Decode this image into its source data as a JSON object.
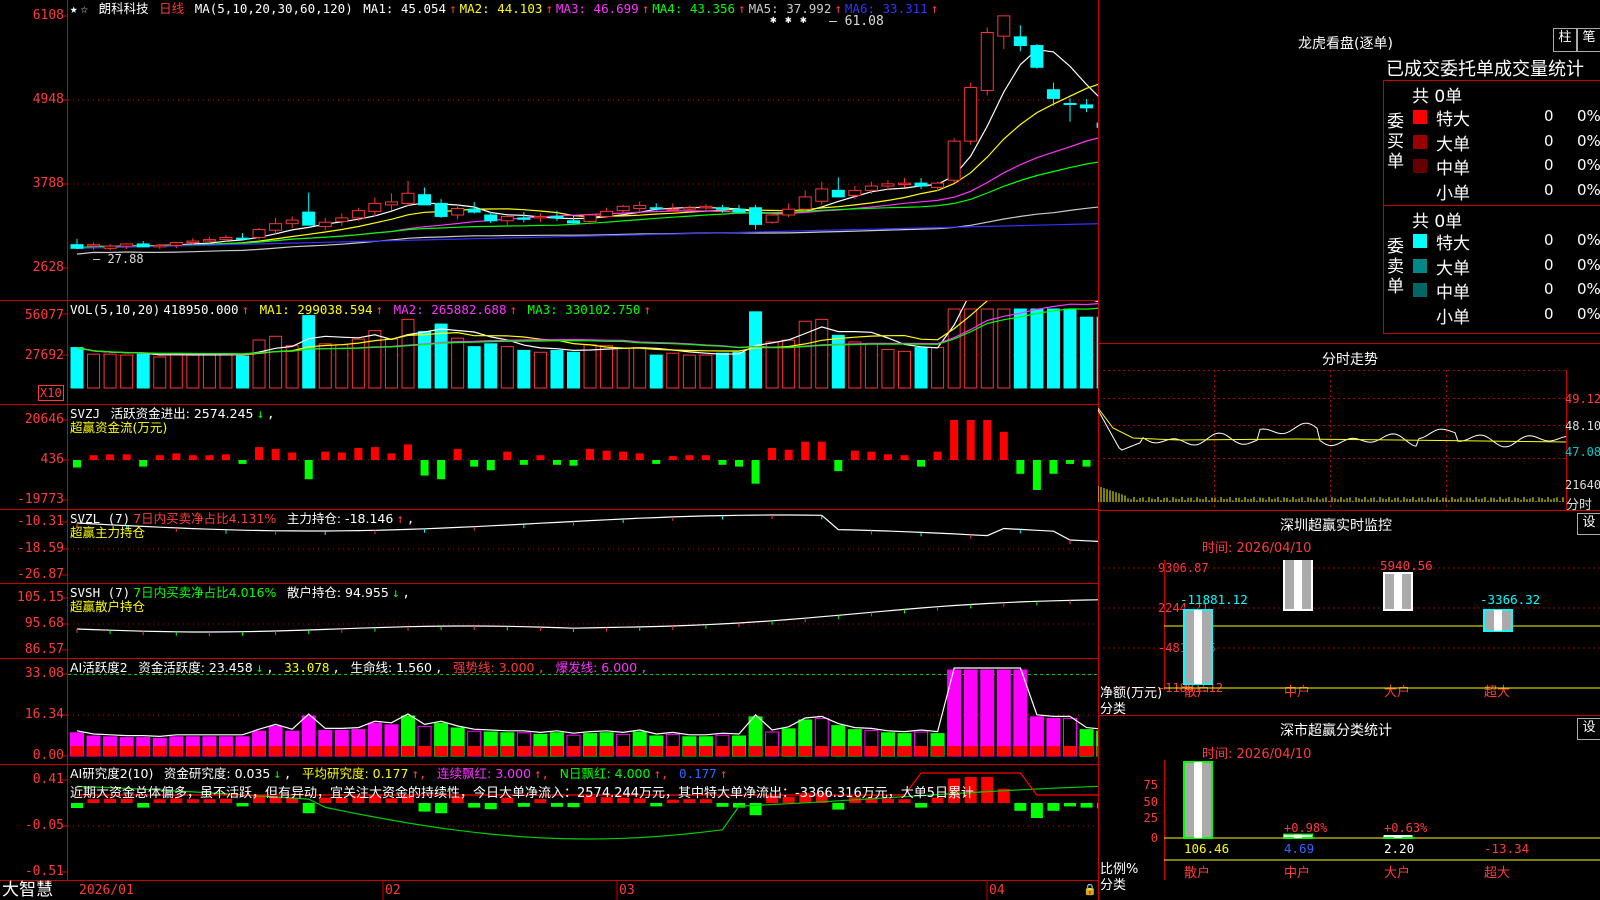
{
  "stock": {
    "name": "朗科科技",
    "period": "日线"
  },
  "main_header": {
    "ma_params": "MA(5,10,20,30,60,120)",
    "ma": [
      {
        "label": "MA1:",
        "value": "45.054",
        "arrow": "↑",
        "color": "#ffffff"
      },
      {
        "label": "MA2:",
        "value": "44.103",
        "arrow": "↑",
        "color": "#ffff00"
      },
      {
        "label": "MA3:",
        "value": "46.699",
        "arrow": "↑",
        "color": "#ff33ff"
      },
      {
        "label": "MA4:",
        "value": "43.356",
        "arrow": "↑",
        "color": "#00ff00"
      },
      {
        "label": "MA5:",
        "value": "37.992",
        "arrow": "↑",
        "color": "#cccccc"
      },
      {
        "label": "MA6:",
        "value": "33.311",
        "arrow": "↑",
        "color": "#3333ff"
      }
    ],
    "high_label": "61.08",
    "low_label": "27.88"
  },
  "y_axes": {
    "price": [
      "6108",
      "4948",
      "3788",
      "2628"
    ],
    "vol": [
      "56077",
      "27692"
    ],
    "vol_unit": "X10",
    "svzj": [
      "20646",
      "436",
      "-19773"
    ],
    "svzl": [
      "-10.31",
      "-18.59",
      "-26.87"
    ],
    "svsh": [
      "105.15",
      "95.68",
      "86.57"
    ],
    "ai2": [
      "33.08",
      "16.34",
      "0.00"
    ],
    "ai": [
      "0.41",
      "-0.05",
      "-0.51"
    ]
  },
  "vol_header": {
    "params": "VOL(5,10,20)",
    "value": "418950.000",
    "arrow": "↑",
    "ma1": "MA1: 299038.594",
    "ma2": "MA2: 265882.688",
    "ma3": "MA3: 330102.750"
  },
  "svzj_header": {
    "name": "SVZJ",
    "label": "活跃资金进出: 2574.245",
    "arrow": "↓",
    "sub": "超赢资金流(万元)"
  },
  "svzl_header": {
    "name": "SVZL (7)",
    "ratio": "7日内买卖净占比4.131%",
    "label": "主力持仓: -18.146",
    "arrow": "↑",
    "sub": "超赢主力持仓"
  },
  "svsh_header": {
    "name": "SVSH (7)",
    "ratio": "7日内买卖净占比4.016%",
    "label": "散户持仓: 94.955",
    "arrow": "↓",
    "sub": "超赢散户持仓"
  },
  "ai2_header": {
    "name": "AI活跃度2",
    "label": "资金活跃度: 23.458",
    "arrow": "↓",
    "v2": "33.078",
    "life": "生命线: 1.560",
    "strong": "强势线: 3.000",
    "burst": "爆发线: 6.000"
  },
  "ai_header": {
    "name": "AI研究度2(10)",
    "label": "资金研究度: 0.035",
    "arrow": "↓",
    "avg": "平均研究度: 0.177",
    "red": "连续飘红: 3.000",
    "n": "N日飘红: 4.000",
    "v": "0.177",
    "comment": "近期大资金总体偏多，虽不活跃，但有异动，宜关注大资金的持续性，今日大单净流入：2574.244万元，其中特大单净流出：-3366.316万元，大单5日累计"
  },
  "bottom": {
    "brand": "大智慧",
    "dates": [
      "2026/01",
      "02",
      "03",
      "04"
    ]
  },
  "lhb": {
    "title": "龙虎看盘(逐单)",
    "btn1": "柱",
    "btn2": "笔",
    "header": "已成交委托单成交量统计",
    "buy": {
      "label": "委买单",
      "total": "共 0单",
      "rows": [
        {
          "name": "特大",
          "value": "0",
          "pct": "0%",
          "color": "#ff0000"
        },
        {
          "name": "大单",
          "value": "0",
          "pct": "0%",
          "color": "#990000"
        },
        {
          "name": "中单",
          "value": "0",
          "pct": "0%",
          "color": "#660000"
        },
        {
          "name": "小单",
          "value": "0",
          "pct": "0%",
          "color": ""
        }
      ]
    },
    "sell": {
      "label": "委卖单",
      "total": "共 0单",
      "rows": [
        {
          "name": "特大",
          "value": "0",
          "pct": "0%",
          "color": "#00ffff"
        },
        {
          "name": "大单",
          "value": "0",
          "pct": "0%",
          "color": "#008888"
        },
        {
          "name": "中单",
          "value": "0",
          "pct": "0%",
          "color": "#006666"
        },
        {
          "name": "小单",
          "value": "0",
          "pct": "0%",
          "color": ""
        }
      ]
    }
  },
  "intraday": {
    "title": "分时走势",
    "prices": [
      "49.12",
      "48.10",
      "47.08"
    ],
    "vol": "21640",
    "vol_unit": "分时"
  },
  "monitor": {
    "title": "深圳超赢实时监控",
    "btn": "设",
    "time": "时间: 2026/04/10",
    "yticks": [
      "9306.87",
      "2244.21",
      "-4818.45",
      "-11881.12"
    ],
    "unit": "净额(万元)",
    "cat_label": "分类",
    "bars": [
      {
        "cat": "散户",
        "value": "-11881.12"
      },
      {
        "cat": "中户",
        "value": "9306.87"
      },
      {
        "cat": "大户",
        "value": "5940.56"
      },
      {
        "cat": "超大",
        "value": "-3366.32"
      }
    ]
  },
  "classify": {
    "title": "深市超赢分类统计",
    "btn": "设",
    "time": "时间: 2026/04/10",
    "yticks": [
      "75",
      "50",
      "25",
      "0"
    ],
    "unit": "比例%",
    "cat_label": "分类",
    "bars": [
      {
        "cat": "散户",
        "value": "106.46",
        "chg": ""
      },
      {
        "cat": "中户",
        "value": "4.69",
        "chg": "+0.98%"
      },
      {
        "cat": "大户",
        "value": "2.20",
        "chg": "+0.63%"
      },
      {
        "cat": "超大",
        "value": "-13.34",
        "chg": ""
      }
    ]
  },
  "colors": {
    "up": "#ff3333",
    "down": "#00ffff",
    "grid": "#aa0000",
    "frame": "#cc0000"
  },
  "chart_data": {
    "type": "candlestick",
    "ohlc": [
      [
        29.5,
        30.3,
        28.9,
        29.0
      ],
      [
        29.3,
        29.8,
        28.8,
        29.5
      ],
      [
        29.0,
        29.6,
        28.7,
        29.3
      ],
      [
        29.3,
        29.7,
        28.9,
        29.6
      ],
      [
        29.6,
        30.0,
        29.2,
        29.2
      ],
      [
        29.2,
        29.6,
        28.9,
        29.4
      ],
      [
        29.4,
        29.9,
        29.0,
        29.8
      ],
      [
        29.8,
        30.4,
        29.5,
        30.0
      ],
      [
        30.0,
        30.6,
        29.7,
        30.2
      ],
      [
        30.2,
        30.8,
        29.9,
        30.5
      ],
      [
        30.4,
        31.1,
        30.2,
        30.3
      ],
      [
        30.5,
        31.8,
        30.2,
        31.6
      ],
      [
        31.5,
        33.2,
        31.0,
        32.4
      ],
      [
        32.4,
        33.4,
        31.8,
        32.9
      ],
      [
        34.0,
        36.7,
        33.2,
        32.2
      ],
      [
        32.0,
        33.2,
        31.5,
        32.6
      ],
      [
        32.7,
        33.8,
        32.1,
        33.2
      ],
      [
        33.2,
        34.6,
        32.8,
        34.2
      ],
      [
        34.1,
        36.0,
        33.4,
        35.2
      ],
      [
        35.0,
        36.6,
        34.2,
        35.4
      ],
      [
        35.2,
        38.3,
        34.8,
        36.6
      ],
      [
        36.4,
        37.4,
        35.2,
        35.0
      ],
      [
        35.2,
        35.8,
        33.2,
        33.4
      ],
      [
        33.6,
        35.0,
        33.0,
        34.5
      ],
      [
        34.4,
        35.4,
        33.8,
        34.0
      ],
      [
        33.6,
        34.0,
        32.5,
        32.8
      ],
      [
        32.8,
        33.6,
        32.2,
        33.4
      ],
      [
        33.2,
        34.0,
        32.6,
        33.0
      ],
      [
        33.2,
        33.8,
        32.6,
        33.4
      ],
      [
        33.4,
        34.2,
        32.8,
        33.2
      ],
      [
        32.8,
        33.5,
        32.4,
        32.5
      ],
      [
        32.7,
        33.6,
        32.3,
        33.6
      ],
      [
        33.4,
        34.6,
        33.2,
        34.1
      ],
      [
        34.2,
        35.0,
        33.8,
        34.8
      ],
      [
        34.5,
        35.5,
        34.0,
        34.9
      ],
      [
        34.6,
        35.2,
        34.2,
        34.5
      ],
      [
        34.3,
        35.2,
        34.0,
        34.4
      ],
      [
        34.4,
        34.9,
        34.0,
        34.6
      ],
      [
        34.6,
        35.1,
        34.2,
        34.8
      ],
      [
        34.6,
        35.0,
        33.9,
        34.4
      ],
      [
        34.4,
        35.0,
        34.0,
        34.0
      ],
      [
        34.6,
        35.0,
        31.6,
        32.3
      ],
      [
        32.6,
        33.9,
        32.4,
        33.6
      ],
      [
        33.6,
        35.2,
        33.3,
        34.4
      ],
      [
        34.4,
        37.0,
        34.0,
        36.1
      ],
      [
        35.5,
        38.2,
        35.0,
        37.2
      ],
      [
        37.0,
        38.8,
        36.5,
        36.1
      ],
      [
        36.3,
        37.6,
        35.8,
        37.0
      ],
      [
        37.0,
        38.2,
        36.5,
        37.6
      ],
      [
        37.6,
        38.4,
        37.0,
        37.9
      ],
      [
        37.8,
        38.7,
        37.4,
        38.0
      ],
      [
        38.0,
        38.7,
        37.2,
        37.6
      ],
      [
        37.4,
        38.2,
        36.9,
        38.0
      ],
      [
        38.4,
        44.2,
        38.0,
        43.8
      ],
      [
        43.8,
        51.9,
        43.3,
        51.2
      ],
      [
        50.8,
        59.5,
        50.1,
        58.8
      ],
      [
        58.3,
        61.1,
        56.5,
        61.1
      ],
      [
        58.2,
        59.8,
        56.2,
        57.0
      ],
      [
        57.0,
        57.2,
        53.8,
        54.0
      ],
      [
        50.9,
        51.9,
        48.7,
        49.7
      ],
      [
        49.0,
        49.7,
        46.5,
        48.9
      ],
      [
        48.8,
        49.6,
        47.8,
        48.4
      ],
      [
        46.3,
        47.2,
        45.6,
        45.7
      ],
      [
        46.0,
        47.4,
        44.9,
        45.4
      ],
      [
        45.0,
        46.2,
        44.3,
        45.5
      ],
      [
        45.8,
        46.3,
        44.8,
        45.0
      ],
      [
        44.6,
        45.8,
        42.4,
        43.3
      ],
      [
        45.7,
        45.8,
        44.0,
        44.5
      ],
      [
        45.5,
        45.8,
        43.4,
        43.9
      ],
      [
        44.8,
        45.0,
        42.5,
        43.0
      ],
      [
        42.9,
        43.6,
        42.0,
        43.3
      ],
      [
        43.4,
        44.2,
        43.0,
        44.1
      ],
      [
        44.1,
        45.8,
        43.6,
        45.6
      ],
      [
        46.0,
        47.6,
        45.5,
        47.3
      ],
      [
        47.0,
        47.9,
        46.2,
        46.8
      ]
    ]
  }
}
